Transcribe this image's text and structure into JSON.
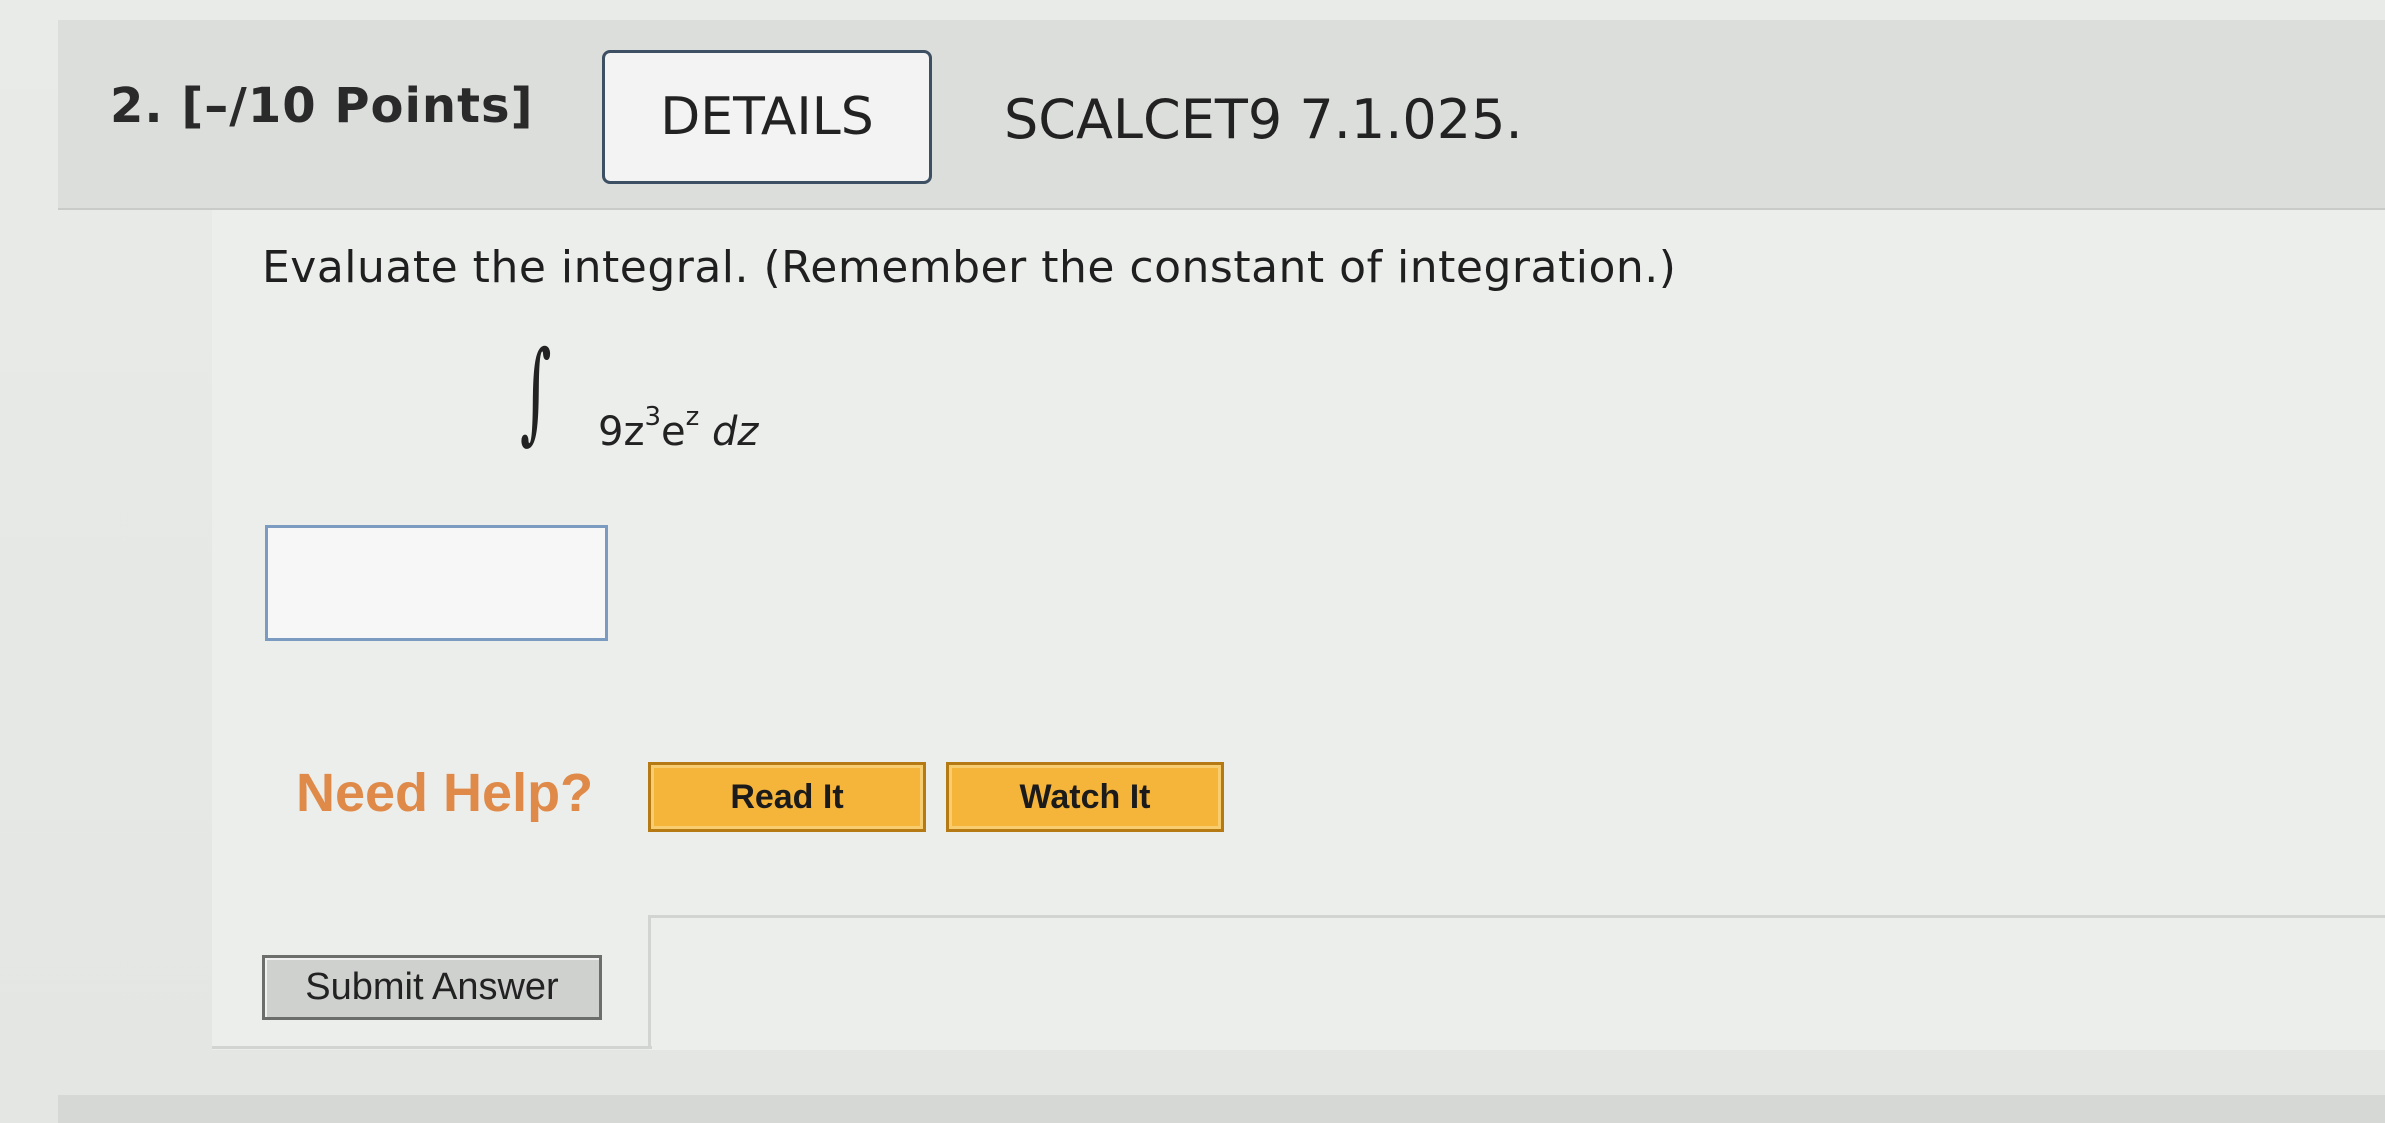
{
  "question": {
    "number_points": "2.  [–/10 Points]",
    "details_label": "DETAILS",
    "source": "SCALCET9 7.1.025."
  },
  "problem": {
    "prompt": "Evaluate the integral. (Remember the constant of integration.)",
    "integral_sign": "∫",
    "integrand_coef": "9z",
    "integrand_exp1": "3",
    "integrand_base2": "e",
    "integrand_exp2": "z",
    "integrand_dz": "dz"
  },
  "answer": {
    "value": ""
  },
  "help": {
    "label": "Need Help?",
    "read_it": "Read It",
    "watch_it": "Watch It"
  },
  "submit": {
    "label": "Submit Answer"
  },
  "colors": {
    "help_text": "#e08a4a",
    "help_button_bg": "#f5b43a",
    "details_border": "#3d4f63",
    "input_border": "#7b9cc0"
  }
}
